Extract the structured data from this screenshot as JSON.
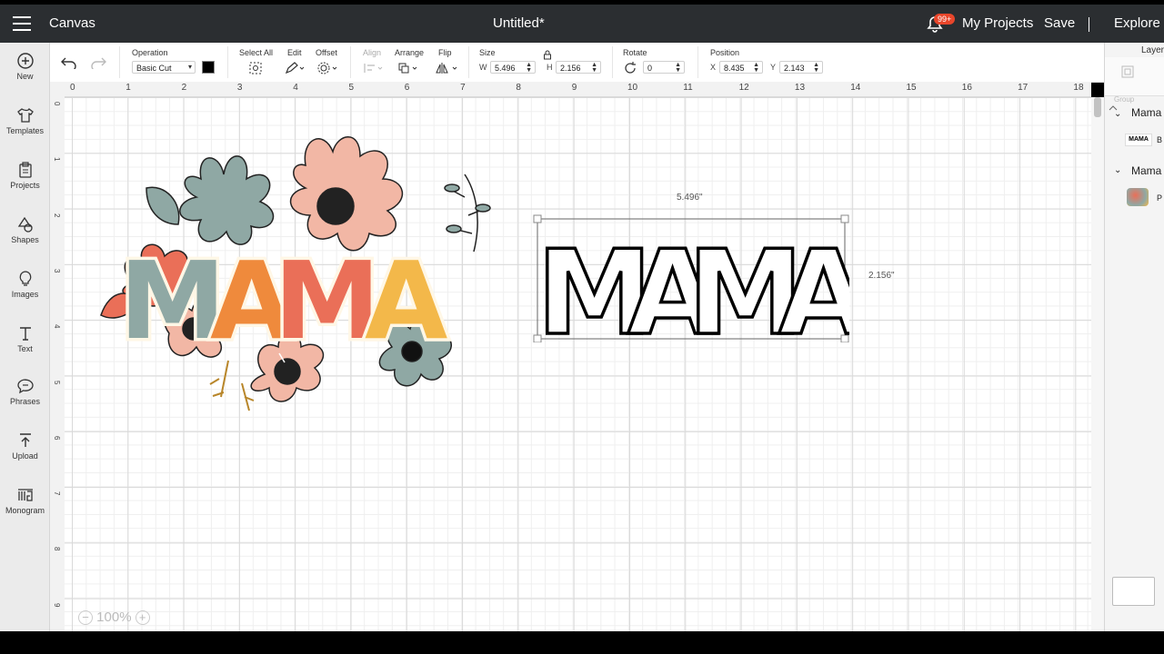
{
  "header": {
    "app_label": "Canvas",
    "doc_title": "Untitled*",
    "notif_badge": "99+",
    "my_projects": "My Projects",
    "save": "Save",
    "explore": "Explore"
  },
  "toolbar": {
    "operation_label": "Operation",
    "operation_value": "Basic Cut",
    "operation_color": "#000000",
    "select_all_label": "Select All",
    "edit_label": "Edit",
    "offset_label": "Offset",
    "align_label": "Align",
    "arrange_label": "Arrange",
    "flip_label": "Flip",
    "size_label": "Size",
    "w_label": "W",
    "w_value": "5.496",
    "h_label": "H",
    "h_value": "2.156",
    "rotate_label": "Rotate",
    "rotate_value": "0",
    "position_label": "Position",
    "x_label": "X",
    "x_value": "8.435",
    "y_label": "Y",
    "y_value": "2.143"
  },
  "left_nav": [
    {
      "label": "New",
      "icon": "plus-circle-icon"
    },
    {
      "label": "Templates",
      "icon": "shirt-icon"
    },
    {
      "label": "Projects",
      "icon": "clipboard-icon"
    },
    {
      "label": "Shapes",
      "icon": "shapes-icon"
    },
    {
      "label": "Images",
      "icon": "lightbulb-icon"
    },
    {
      "label": "Text",
      "icon": "text-icon"
    },
    {
      "label": "Phrases",
      "icon": "speech-bubble-icon"
    },
    {
      "label": "Upload",
      "icon": "upload-icon"
    },
    {
      "label": "Monogram",
      "icon": "monogram-icon"
    }
  ],
  "ruler": {
    "top": [
      "0",
      "1",
      "2",
      "3",
      "4",
      "5",
      "6",
      "7",
      "8",
      "9",
      "10",
      "11",
      "12",
      "13",
      "14",
      "15",
      "16",
      "17",
      "18"
    ],
    "left": [
      "0",
      "1",
      "2",
      "3",
      "4",
      "5",
      "6",
      "7",
      "8",
      "9"
    ]
  },
  "canvas": {
    "design_text": "MAMA",
    "dim_width": "5.496\"",
    "dim_height": "2.156\"",
    "zoom": "100%",
    "colors": [
      "#8fa8a4",
      "#ef8a3c",
      "#ea6f58",
      "#f3b84a"
    ]
  },
  "layers_panel": {
    "tab": "Layers",
    "group_label": "Group",
    "layer1": "Mama",
    "layer1_sub": "B",
    "layer2": "Mama",
    "layer2_sub": "P"
  }
}
